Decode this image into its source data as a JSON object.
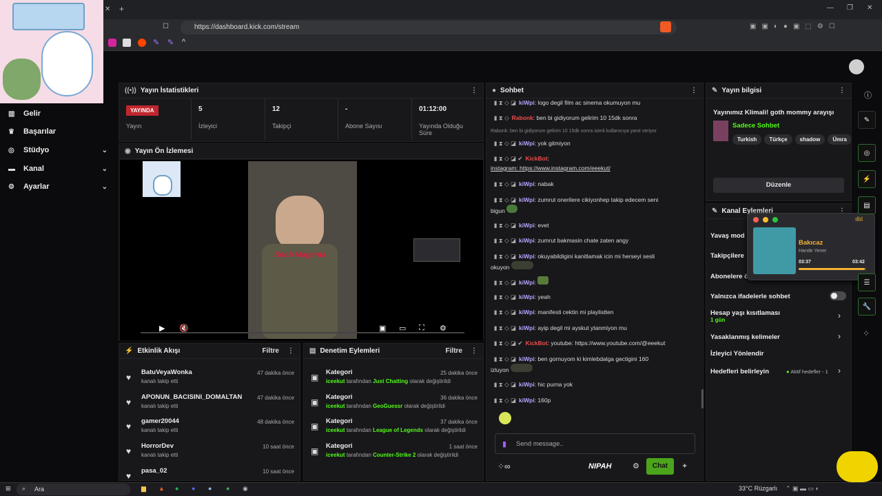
{
  "browser": {
    "url": "https://dashboard.kick.com/stream"
  },
  "sidebar": {
    "items": [
      {
        "label": "Gelir"
      },
      {
        "label": "Başarılar"
      },
      {
        "label": "Stüdyo"
      },
      {
        "label": "Kanal"
      },
      {
        "label": "Ayarlar"
      }
    ]
  },
  "stats": {
    "title": "Yayın İstatistikleri",
    "live_badge": "YAYINDA",
    "live_label": "Yayın",
    "viewers_value": "5",
    "viewers_label": "İzleyici",
    "followers_value": "12",
    "followers_label": "Takipçi",
    "subs_value": "-",
    "subs_label": "Abone Sayısı",
    "uptime_value": "01:12:00",
    "uptime_label": "Yayında Olduğu Süre"
  },
  "preview": {
    "title": "Yayın Ön İzlemesi",
    "overlay_text": "Snob Magenta"
  },
  "activity": {
    "title": "Etkinlik Akışı",
    "filter": "Filtre",
    "items": [
      {
        "name": "BatuVeyaWonka",
        "action": "kanalı takip etti",
        "time": "47 dakika önce"
      },
      {
        "name": "APONUN_BACISINI_DOMALTAN",
        "action": "kanalı takip etti",
        "time": "47 dakika önce"
      },
      {
        "name": "gamer20044",
        "action": "kanalı takip etti",
        "time": "48 dakika önce"
      },
      {
        "name": "HorrorDev",
        "action": "kanalı takip etti",
        "time": "10 saat önce"
      },
      {
        "name": "pasa_02",
        "action": "",
        "time": "10 saat önce"
      }
    ]
  },
  "moderation": {
    "title": "Denetim Eylemleri",
    "filter": "Filtre",
    "items": [
      {
        "label": "Kategori",
        "user": "iceekut",
        "mid": "tarafından",
        "cat": "Just Chatting",
        "end": "olarak değiştirildi",
        "time": "25 dakika önce"
      },
      {
        "label": "Kategori",
        "user": "iceekut",
        "mid": "tarafından",
        "cat": "GeoGuessr",
        "end": "olarak değiştirildi",
        "time": "36 dakika önce"
      },
      {
        "label": "Kategori",
        "user": "iceekut",
        "mid": "tarafından",
        "cat": "League of Legends",
        "end": "olarak değiştirildi",
        "time": "37 dakika önce"
      },
      {
        "label": "Kategori",
        "user": "iceekut",
        "mid": "tarafından",
        "cat": "Counter-Strike 2",
        "end": "olarak değiştirildi",
        "time": "1 saat önce"
      }
    ]
  },
  "chat": {
    "title": "Sohbet",
    "reply_note": "Rabonk: ben bi gidiyorum gelirim 10 15dk sonra isimli kullanıcıya yanıt veriyor",
    "messages": [
      {
        "user": "kiWpi",
        "text": ": logo degil film ac sinema okumuyon mu"
      },
      {
        "user": "Rabonk",
        "text": ": ben bi gidiyorum gelirim 10 15dk sonra"
      },
      {
        "user": "kiWpi",
        "text": ": yok gitmiyon"
      },
      {
        "user": "KickBot",
        "text": ":",
        "line2": "instagram: https://www.instagram.com/eeekut/"
      },
      {
        "user": "kiWpi",
        "text": ": nabak"
      },
      {
        "user": "kiWpi",
        "text": ": zumrut onerilere cikiyonhep takip edecem seni",
        "line2": "bigun"
      },
      {
        "user": "kiWpi",
        "text": ": evet"
      },
      {
        "user": "kiWpi",
        "text": ": zumrut bakmasin chate zaten angy"
      },
      {
        "user": "kiWpi",
        "text": ": okuyabildigini kanitlamak icin mi herseyi sesli",
        "line2": "okuyon"
      },
      {
        "user": "kiWpi",
        "text": ":"
      },
      {
        "user": "kiWpi",
        "text": ": yeah"
      },
      {
        "user": "kiWpi",
        "text": ": manifesti cektin mi playlistten"
      },
      {
        "user": "kiWpi",
        "text": ": ayip degil mi ayskut ytanmiyon mu"
      },
      {
        "user": "KickBot",
        "text": ": youtube: https://www.youtube.com/@eeekut"
      },
      {
        "user": "kiWpi",
        "text": ": ben gornuyom ki kimlebdalga gectigini 160",
        "line2": "izluyon"
      },
      {
        "user": "kiWpi",
        "text": ": hic purna yok"
      },
      {
        "user": "kiWpi",
        "text": ": 160p"
      }
    ],
    "placeholder": "Send message..",
    "chat_button": "Chat",
    "brand": "NIPAH"
  },
  "info": {
    "title": "Yayın bilgisi",
    "stream_title": "Yayınımız Klimali! goth mommy arayışı",
    "category": "Sadece Sohbet",
    "tags": [
      "Turkish",
      "Türkçe",
      "shadow",
      "Ümra"
    ],
    "edit_button": "Düzenle"
  },
  "actions": {
    "title": "Kanal Eylemleri",
    "slow": "Yavaş mod",
    "followers": "Takipçilere",
    "subs": "Abonelere ö",
    "emote": "Yalnızca ifadelerle sohbet",
    "age_label": "Hesap yaşı kısıtlaması",
    "age_value": "1 gün",
    "banned": "Yasaklanmış kelimeler",
    "redirect": "İzleyici Yönlendir",
    "goals": "Hedefleri belirleyin",
    "goals_status": "Aktif hedefler - 1"
  },
  "music": {
    "song": "Bakıcaz",
    "artist": "Hande Yener",
    "elapsed": "03:37",
    "total": "03:42",
    "progress": 0.98
  },
  "taskbar": {
    "search": "Ara",
    "weather": "33°C  Rüzgarlı"
  },
  "colors": {
    "accent": "#53fc18",
    "live": "#c0262d"
  }
}
